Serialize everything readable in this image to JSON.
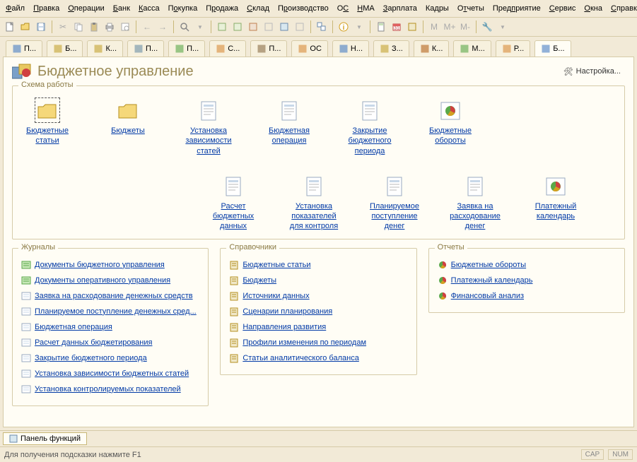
{
  "menu": [
    "Файл",
    "Правка",
    "Операции",
    "Банк",
    "Касса",
    "Покупка",
    "Продажа",
    "Склад",
    "Производство",
    "ОС",
    "НМА",
    "Зарплата",
    "Кадры",
    "Отчеты",
    "Предприятие",
    "Сервис",
    "Окна",
    "Справка"
  ],
  "menu_underline": [
    0,
    0,
    0,
    0,
    0,
    1,
    1,
    0,
    1,
    1,
    0,
    0,
    7,
    1,
    4,
    0,
    0,
    0
  ],
  "tabs": [
    {
      "label": "П...",
      "color": "#4a7fc5"
    },
    {
      "label": "Б...",
      "color": "#c4a432"
    },
    {
      "label": "К...",
      "color": "#c4a432"
    },
    {
      "label": "П...",
      "color": "#6d8fa6"
    },
    {
      "label": "П...",
      "color": "#5aa84a"
    },
    {
      "label": "С...",
      "color": "#d98c3a"
    },
    {
      "label": "П...",
      "color": "#8b6f47"
    },
    {
      "label": "ОС",
      "color": "#d98c3a"
    },
    {
      "label": "Н...",
      "color": "#4a7fc5"
    },
    {
      "label": "З...",
      "color": "#c4a432"
    },
    {
      "label": "К...",
      "color": "#b5651d"
    },
    {
      "label": "М...",
      "color": "#5aa84a"
    },
    {
      "label": "Р...",
      "color": "#d98c3a"
    },
    {
      "label": "Б...",
      "color": "#4a7fc5",
      "active": true
    }
  ],
  "title": "Бюджетное управление",
  "settings_label": "Настройка...",
  "scheme_label": "Схема работы",
  "scheme_row1": [
    {
      "label": "Бюджетные статьи",
      "icon": "folder"
    },
    {
      "label": "Бюджеты",
      "icon": "folder"
    },
    {
      "label": "Установка зависимости статей",
      "icon": "doc"
    },
    {
      "label": "Бюджетная операция",
      "icon": "doc"
    },
    {
      "label": "Закрытие бюджетного периода",
      "icon": "doc"
    },
    {
      "label": "Бюджетные обороты",
      "icon": "pie"
    }
  ],
  "scheme_row2": [
    {
      "label": "Расчет бюджетных данных",
      "icon": "doc"
    },
    {
      "label": "Установка показателей для контроля",
      "icon": "doc"
    },
    {
      "label": "Планируемое поступление денег",
      "icon": "doc"
    },
    {
      "label": "Заявка на расходование денег",
      "icon": "doc"
    },
    {
      "label": "Платежный календарь",
      "icon": "pie"
    }
  ],
  "col1_label": "Журналы",
  "col1_items": [
    {
      "icon": "journal-g",
      "label": "Документы бюджетного управления"
    },
    {
      "icon": "journal-g",
      "label": "Документы оперативного управления"
    },
    {
      "icon": "journal",
      "label": "Заявка на расходование денежных средств"
    },
    {
      "icon": "journal",
      "label": "Планируемое поступление денежных сред..."
    },
    {
      "icon": "journal",
      "label": "Бюджетная операция"
    },
    {
      "icon": "journal",
      "label": "Расчет данных бюджетирования"
    },
    {
      "icon": "journal",
      "label": "Закрытие бюджетного периода"
    },
    {
      "icon": "journal",
      "label": "Установка зависимости бюджетных статей"
    },
    {
      "icon": "journal",
      "label": "Установка контролируемых показателей"
    }
  ],
  "col2_label": "Справочники",
  "col2_items": [
    {
      "icon": "book",
      "label": "Бюджетные статьи"
    },
    {
      "icon": "book",
      "label": "Бюджеты"
    },
    {
      "icon": "book",
      "label": "Источники данных"
    },
    {
      "icon": "book",
      "label": "Сценарии планирования"
    },
    {
      "icon": "book",
      "label": "Направления развития"
    },
    {
      "icon": "book",
      "label": "Профили изменения по периодам"
    },
    {
      "icon": "book",
      "label": "Статьи аналитического баланса"
    }
  ],
  "col3_label": "Отчеты",
  "col3_items": [
    {
      "icon": "pie",
      "label": "Бюджетные обороты"
    },
    {
      "icon": "pie",
      "label": "Платежный календарь"
    },
    {
      "icon": "pie",
      "label": "Финансовый анализ"
    }
  ],
  "bottom_tab": "Панель функций",
  "status_hint": "Для получения подсказки нажмите F1",
  "status_right": [
    "CAP",
    "NUM"
  ]
}
